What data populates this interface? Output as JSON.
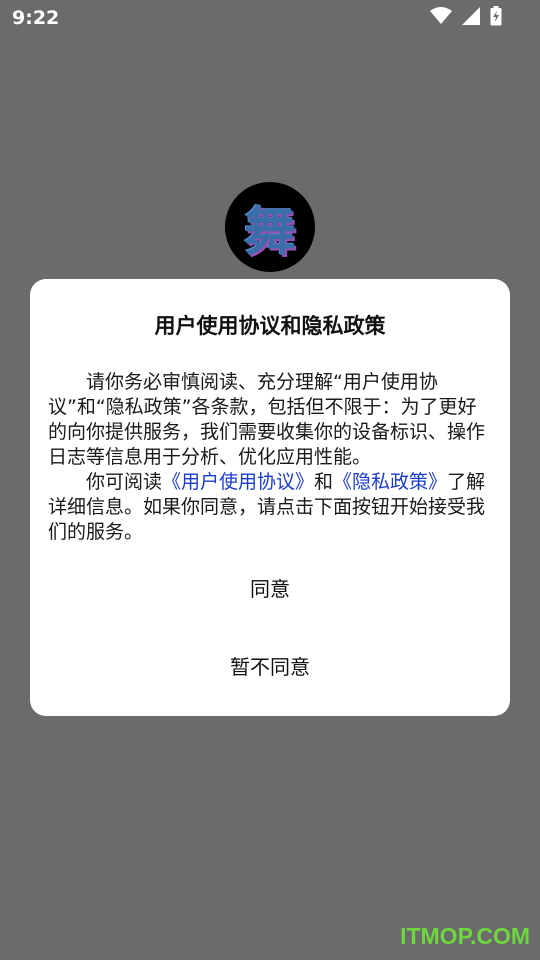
{
  "status_bar": {
    "time": "9:22",
    "icons": [
      "wifi-icon",
      "signal-icon",
      "battery-charging-icon"
    ]
  },
  "app_logo": {
    "glyph": "舞"
  },
  "dialog": {
    "title": "用户使用协议和隐私政策",
    "paragraph1": "请你务必审慎阅读、充分理解“用户使用协议”和“隐私政策”各条款，包括但不限于：为了更好的向你提供服务，我们需要收集你的设备标识、操作日志等信息用于分析、优化应用性能。",
    "paragraph2_prefix": "你可阅读",
    "user_agreement_link": "《用户使用协议》",
    "paragraph2_and": "和",
    "privacy_policy_link": "《隐私政策》",
    "paragraph2_suffix": "了解详细信息。如果你同意，请点击下面按钮开始接受我们的服务。",
    "agree_label": "同意",
    "disagree_label": "暂不同意"
  },
  "watermark": "ITMOP.COM",
  "colors": {
    "overlay": "#6b6b6b",
    "link": "#1a3ccc",
    "watermark": "#6ed63f"
  }
}
